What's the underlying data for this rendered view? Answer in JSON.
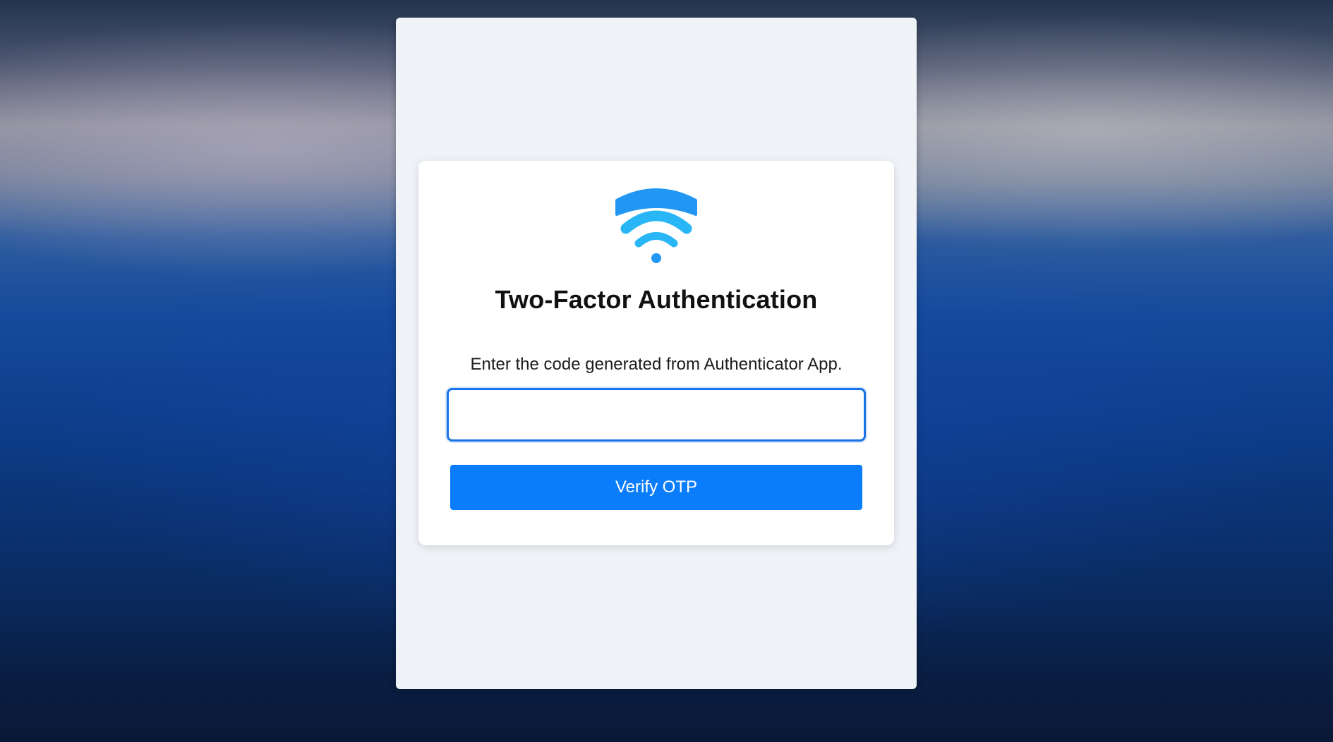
{
  "colors": {
    "accent": "#0a7dfc",
    "input_focus_border": "#1a73e8",
    "icon_primary": "#2196f3",
    "icon_secondary": "#29b6f6",
    "panel_bg": "#eff2f7",
    "card_bg": "#ffffff"
  },
  "card": {
    "logo_icon": "wifi-shield-icon",
    "title": "Two-Factor Authentication",
    "subtitle": "Enter the code generated from Authenticator App.",
    "otp_input": {
      "value": "",
      "placeholder": ""
    },
    "verify_button_label": "Verify OTP"
  }
}
